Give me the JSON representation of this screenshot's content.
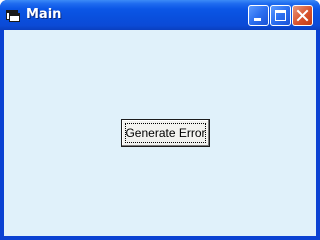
{
  "window": {
    "title": "Main"
  },
  "titlebar_buttons": {
    "minimize": "minimize-icon",
    "maximize": "maximize-icon",
    "close": "close-icon"
  },
  "content": {
    "generate_button_label": "Generate Error"
  },
  "colors": {
    "titlebar": "#0b56e6",
    "client_background": "#e0f1fa",
    "close_button": "#d9522c"
  }
}
